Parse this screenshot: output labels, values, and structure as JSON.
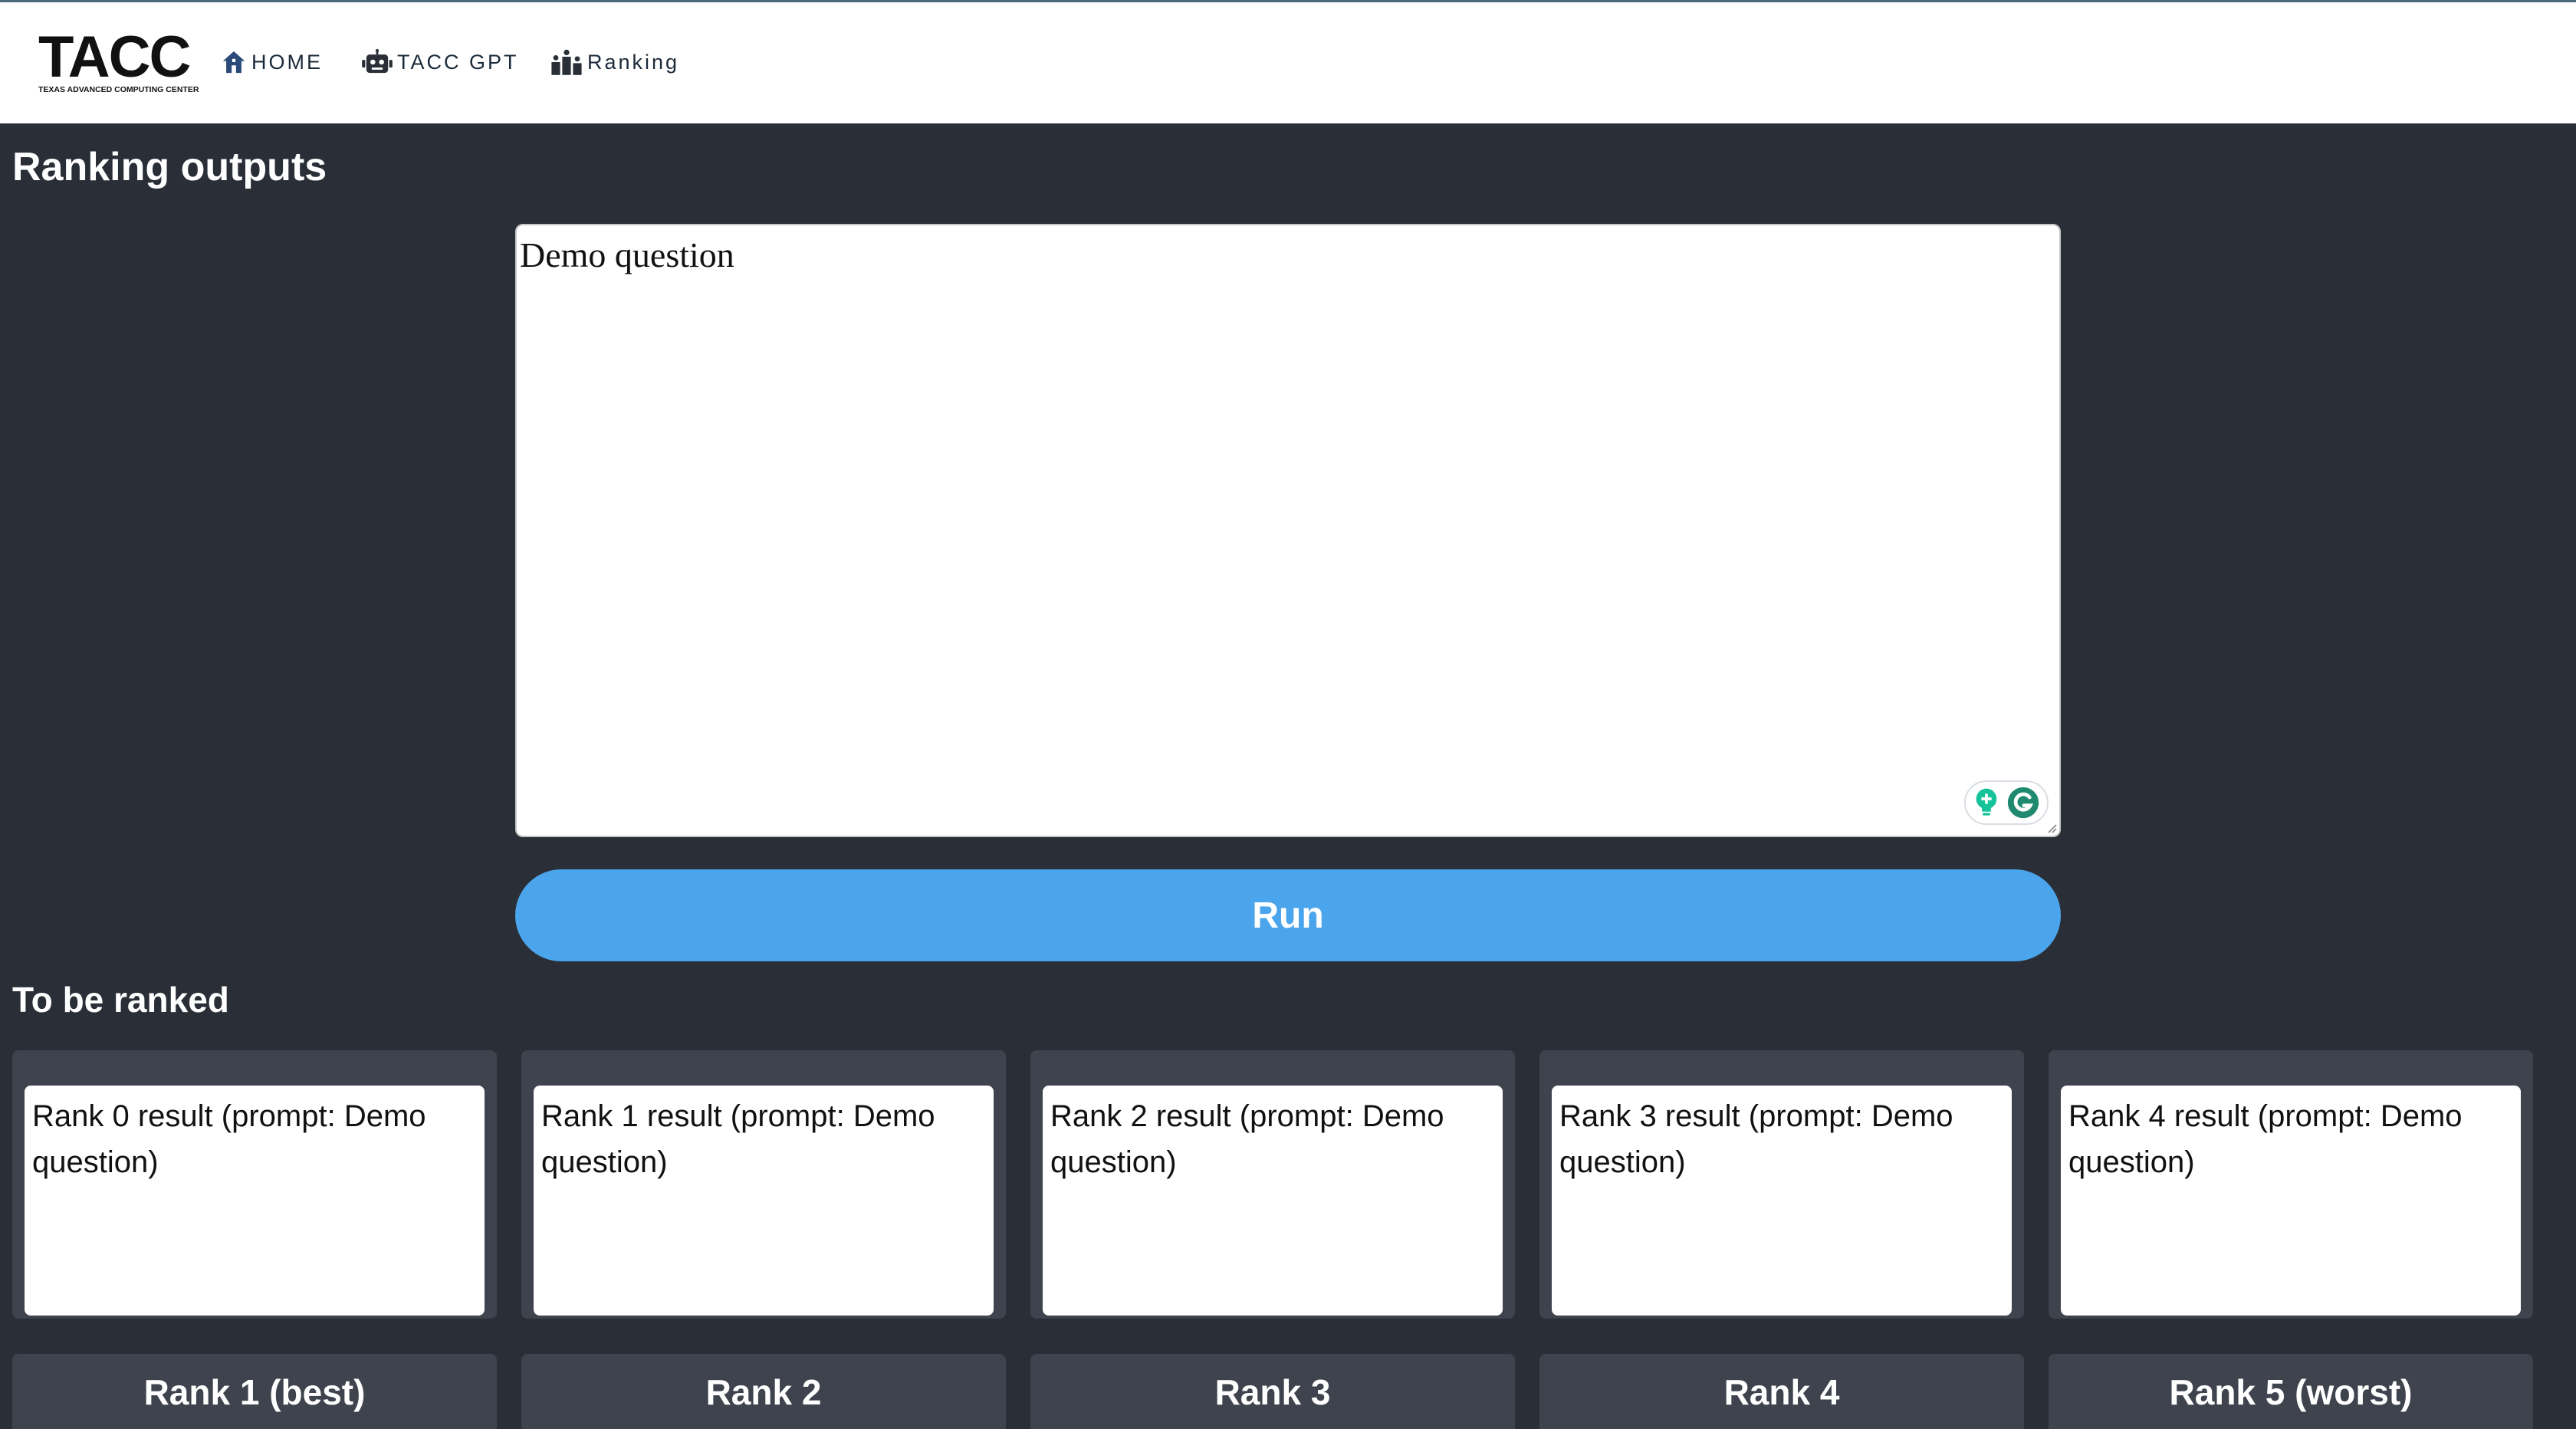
{
  "colors": {
    "background": "#2a2e37",
    "navbar": "#ffffff",
    "nav_text": "#1b2a3a",
    "card": "#3f434d",
    "run_button": "#4aa5ec",
    "grammarly": "#15c39a"
  },
  "logo": {
    "main": "TACC",
    "sub": "TEXAS ADVANCED COMPUTING CENTER"
  },
  "nav": {
    "items": [
      {
        "label": "HOME",
        "icon": "home-icon"
      },
      {
        "label": "TACC GPT",
        "icon": "robot-icon"
      },
      {
        "label": "Ranking",
        "icon": "podium-icon"
      }
    ]
  },
  "page": {
    "title": "Ranking outputs"
  },
  "question": {
    "value": "Demo question"
  },
  "run": {
    "label": "Run"
  },
  "to_be_ranked": {
    "title": "To be ranked",
    "cards": [
      {
        "text": "Rank 0 result (prompt: Demo question)"
      },
      {
        "text": "Rank 1 result (prompt: Demo question)"
      },
      {
        "text": "Rank 2 result (prompt: Demo question)"
      },
      {
        "text": "Rank 3 result (prompt: Demo question)"
      },
      {
        "text": "Rank 4 result (prompt: Demo question)"
      }
    ]
  },
  "ranks": [
    {
      "label": "Rank 1 (best)"
    },
    {
      "label": "Rank 2"
    },
    {
      "label": "Rank 3"
    },
    {
      "label": "Rank 4"
    },
    {
      "label": "Rank 5 (worst)"
    }
  ]
}
